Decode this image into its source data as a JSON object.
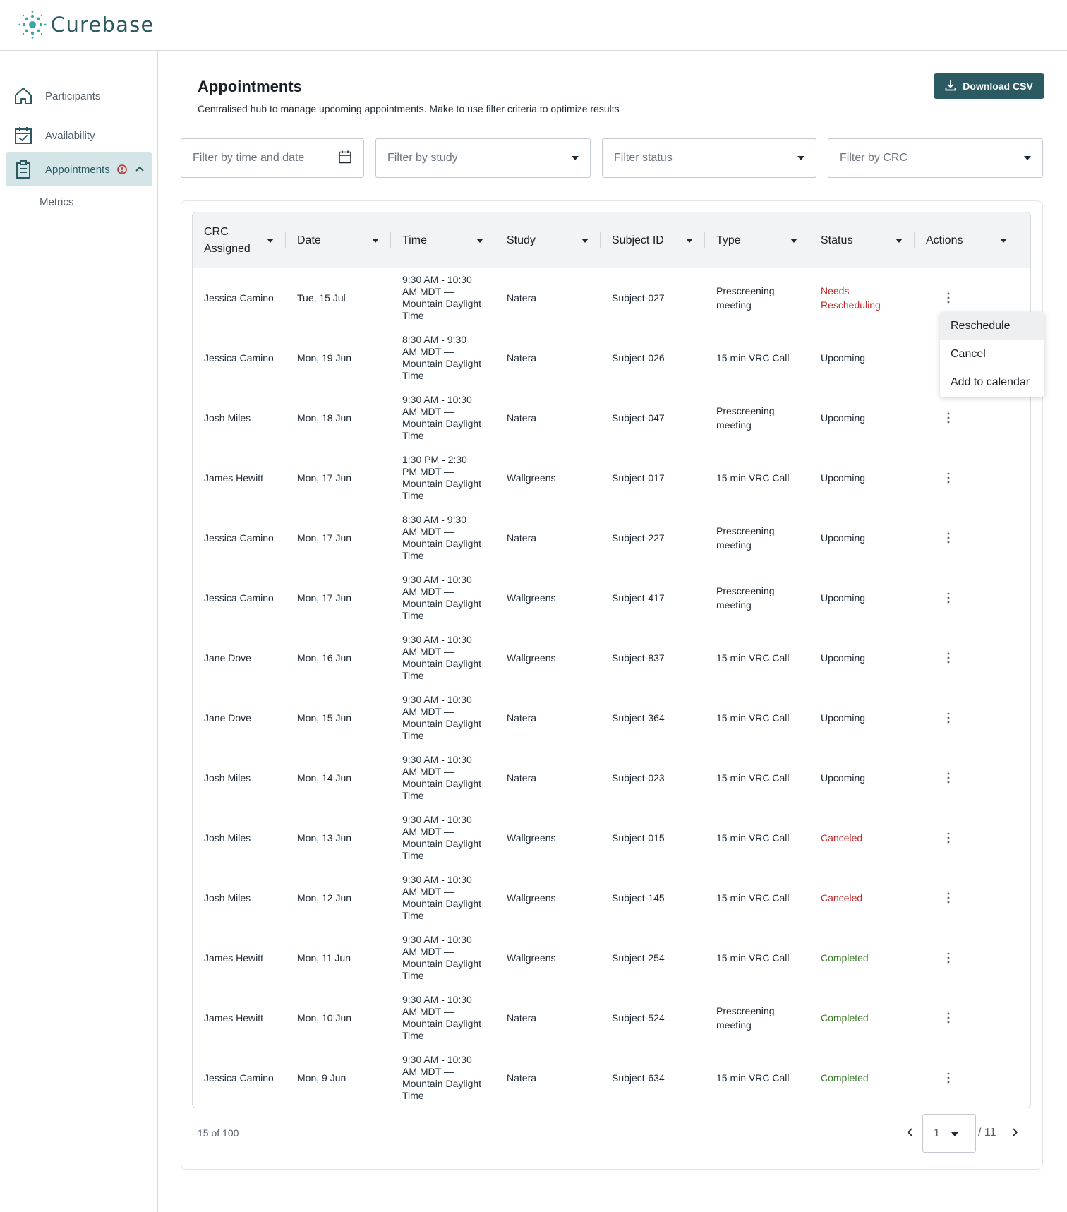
{
  "app": {
    "name": "Curebase"
  },
  "sidebar": {
    "items": [
      {
        "label": "Participants",
        "icon": "home-icon"
      },
      {
        "label": "Availability",
        "icon": "calendar-check-icon"
      },
      {
        "label": "Appointments",
        "icon": "clipboard-icon",
        "active": true,
        "alert": true
      }
    ],
    "sub_items": [
      {
        "label": "Metrics"
      }
    ]
  },
  "header": {
    "title": "Appointments",
    "subtitle": "Centralised hub to manage upcoming appointments. Make to use filter criteria to optimize results",
    "download_label": "Download CSV"
  },
  "filters": {
    "date": {
      "placeholder": "Filter by time and date"
    },
    "study": {
      "placeholder": "Filter by study"
    },
    "status": {
      "placeholder": "Filter status"
    },
    "crc": {
      "placeholder": "Filter by CRC"
    }
  },
  "table": {
    "columns": [
      "CRC Assigned",
      "Date",
      "Time",
      "Study",
      "Subject ID",
      "Type",
      "Status",
      "Actions"
    ],
    "rows": [
      {
        "crc": "Jessica Camino",
        "date": "Tue, 15 Jul",
        "time": "9:30 AM - 10:30 AM MDT — Mountain Daylight Time",
        "study": "Natera",
        "subject": "Subject-027",
        "type": "Prescreening meeting",
        "status": "Needs Rescheduling",
        "status_kind": "needs"
      },
      {
        "crc": "Jessica Camino",
        "date": "Mon, 19 Jun",
        "time": "8:30 AM - 9:30 AM MDT — Mountain Daylight Time",
        "study": "Natera",
        "subject": "Subject-026",
        "type": "15 min VRC Call",
        "status": "Upcoming",
        "status_kind": "upcoming"
      },
      {
        "crc": "Josh Miles",
        "date": "Mon, 18 Jun",
        "time": "9:30 AM - 10:30 AM MDT — Mountain Daylight Time",
        "study": "Natera",
        "subject": "Subject-047",
        "type": "Prescreening meeting",
        "status": "Upcoming",
        "status_kind": "upcoming"
      },
      {
        "crc": "James Hewitt",
        "date": "Mon, 17 Jun",
        "time": "1:30 PM - 2:30 PM MDT — Mountain Daylight Time",
        "study": "Wallgreens",
        "subject": "Subject-017",
        "type": "15 min VRC Call",
        "status": "Upcoming",
        "status_kind": "upcoming"
      },
      {
        "crc": "Jessica Camino",
        "date": "Mon, 17 Jun",
        "time": "8:30 AM - 9:30 AM MDT — Mountain Daylight Time",
        "study": "Natera",
        "subject": "Subject-227",
        "type": "Prescreening meeting",
        "status": "Upcoming",
        "status_kind": "upcoming"
      },
      {
        "crc": "Jessica Camino",
        "date": "Mon, 17 Jun",
        "time": "9:30 AM - 10:30 AM MDT — Mountain Daylight Time",
        "study": "Wallgreens",
        "subject": "Subject-417",
        "type": "Prescreening meeting",
        "status": "Upcoming",
        "status_kind": "upcoming"
      },
      {
        "crc": "Jane Dove",
        "date": "Mon, 16 Jun",
        "time": "9:30 AM - 10:30 AM MDT — Mountain Daylight Time",
        "study": "Wallgreens",
        "subject": "Subject-837",
        "type": "15 min VRC Call",
        "status": "Upcoming",
        "status_kind": "upcoming"
      },
      {
        "crc": "Jane Dove",
        "date": "Mon, 15 Jun",
        "time": "9:30 AM - 10:30 AM MDT — Mountain Daylight Time",
        "study": "Natera",
        "subject": "Subject-364",
        "type": "15 min VRC Call",
        "status": "Upcoming",
        "status_kind": "upcoming"
      },
      {
        "crc": "Josh Miles",
        "date": "Mon, 14 Jun",
        "time": "9:30 AM - 10:30 AM MDT — Mountain Daylight Time",
        "study": "Natera",
        "subject": "Subject-023",
        "type": "15 min VRC Call",
        "status": "Upcoming",
        "status_kind": "upcoming"
      },
      {
        "crc": "Josh Miles",
        "date": "Mon, 13 Jun",
        "time": "9:30 AM - 10:30 AM MDT — Mountain Daylight Time",
        "study": "Wallgreens",
        "subject": "Subject-015",
        "type": "15 min VRC Call",
        "status": "Canceled",
        "status_kind": "canceled"
      },
      {
        "crc": "Josh Miles",
        "date": "Mon, 12 Jun",
        "time": "9:30 AM - 10:30 AM MDT — Mountain Daylight Time",
        "study": "Wallgreens",
        "subject": "Subject-145",
        "type": "15 min VRC Call",
        "status": "Canceled",
        "status_kind": "canceled"
      },
      {
        "crc": "James Hewitt",
        "date": "Mon, 11 Jun",
        "time": "9:30 AM - 10:30 AM MDT — Mountain Daylight Time",
        "study": "Wallgreens",
        "subject": "Subject-254",
        "type": "15 min VRC Call",
        "status": "Completed",
        "status_kind": "completed"
      },
      {
        "crc": "James Hewitt",
        "date": "Mon, 10 Jun",
        "time": "9:30 AM - 10:30 AM MDT — Mountain Daylight Time",
        "study": "Natera",
        "subject": "Subject-524",
        "type": "Prescreening meeting",
        "status": "Completed",
        "status_kind": "completed"
      },
      {
        "crc": "Jessica Camino",
        "date": "Mon, 9 Jun",
        "time": "9:30 AM - 10:30 AM MDT — Mountain Daylight Time",
        "study": "Natera",
        "subject": "Subject-634",
        "type": "15 min VRC Call",
        "status": "Completed",
        "status_kind": "completed"
      }
    ]
  },
  "action_menu": {
    "items": [
      "Reschedule",
      "Cancel",
      "Add to calendar"
    ]
  },
  "pagination": {
    "summary": "15 of 100",
    "current_page": "1",
    "total_label": "/ 11"
  },
  "colors": {
    "brand": "#2c5a63",
    "active_nav": "#d3e5e7",
    "danger": "#c22b2b",
    "success": "#3c7a2e"
  }
}
